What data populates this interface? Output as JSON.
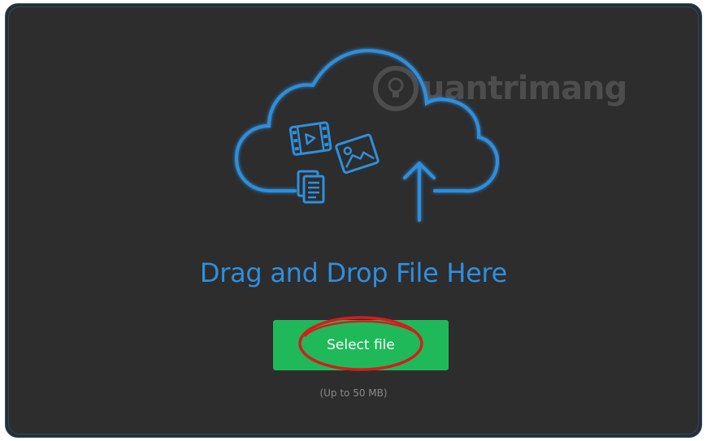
{
  "dropzone": {
    "watermark_text": "uantrimang",
    "title": "Drag and Drop File Here",
    "select_button_label": "Select file",
    "size_hint": "(Up to 50 MB)"
  },
  "colors": {
    "background": "#2d2d2e",
    "accent_blue": "#2f8fdc",
    "button_green": "#1fb959",
    "annotation_red": "#d61c1c",
    "hint_gray": "#8a8a8a"
  },
  "icons": [
    "cloud-icon",
    "video-file-icon",
    "image-file-icon",
    "document-file-icon",
    "upload-arrow-icon"
  ]
}
